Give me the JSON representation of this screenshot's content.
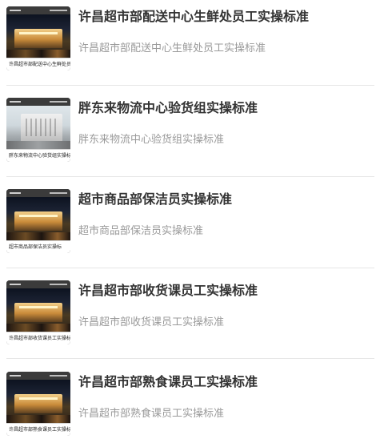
{
  "articles": [
    {
      "title": "许昌超市部配送中心生鲜处员工实操标准",
      "summary": "许昌超市部配送中心生鲜处员工实操标准",
      "thumbnail_caption": "许昌超市部配送中心生鲜处员工实操标",
      "thumbnail_icon": "night-storefront-image-icon"
    },
    {
      "title": "胖东来物流中心验货组实操标准",
      "summary": "胖东来物流中心验货组实操标准",
      "thumbnail_caption": "胖东来物流中心验货组实操标",
      "thumbnail_icon": "warehouse-building-image-icon"
    },
    {
      "title": "超市商品部保洁员实操标准",
      "summary": "超市商品部保洁员实操标准",
      "thumbnail_caption": "超市商品部保洁员实操标",
      "thumbnail_icon": "night-storefront-image-icon"
    },
    {
      "title": "许昌超市部收货课员工实操标准",
      "summary": "许昌超市部收货课员工实操标准",
      "thumbnail_caption": "许昌超市部收货课员工实操标",
      "thumbnail_icon": "night-storefront-image-icon"
    },
    {
      "title": "许昌超市部熟食课员工实操标准",
      "summary": "许昌超市部熟食课员工实操标准",
      "thumbnail_caption": "许昌超市部熟食课员工实操标",
      "thumbnail_icon": "night-storefront-image-icon"
    }
  ],
  "colors": {
    "title": "#333333",
    "summary": "#9a9a9a",
    "divider": "#e6e6e6"
  }
}
